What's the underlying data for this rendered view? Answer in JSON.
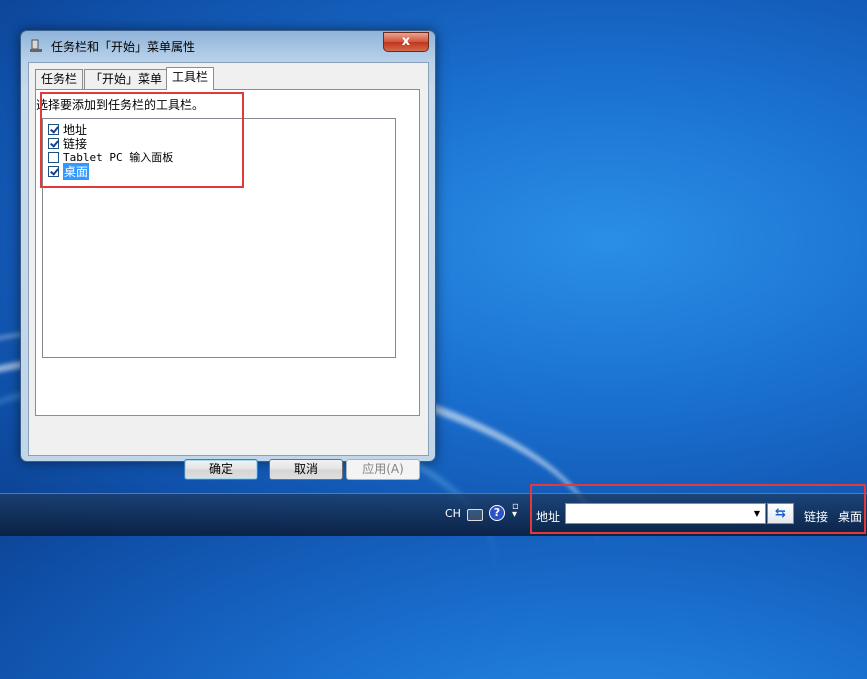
{
  "window": {
    "title": "任务栏和「开始」菜单属性",
    "close_glyph": "x"
  },
  "tabs": [
    {
      "label": "任务栏"
    },
    {
      "label": "「开始」菜单"
    },
    {
      "label": "工具栏"
    }
  ],
  "toolbar_panel": {
    "instruction": "选择要添加到任务栏的工具栏。",
    "items": [
      {
        "label": "地址",
        "checked": true
      },
      {
        "label": "链接",
        "checked": true
      },
      {
        "label": "Tablet PC 输入面板",
        "checked": false
      },
      {
        "label": "桌面",
        "checked": true,
        "selected": true
      }
    ]
  },
  "buttons": {
    "ok": "确定",
    "cancel": "取消",
    "apply": "应用(A)"
  },
  "taskbar": {
    "language": "CH",
    "help_glyph": "?",
    "address_label": "地址",
    "address_value": "",
    "links_label": "链接",
    "desktop_label": "桌面"
  },
  "colors": {
    "highlight_box": "#e23a3a",
    "selection": "#3399ff"
  }
}
